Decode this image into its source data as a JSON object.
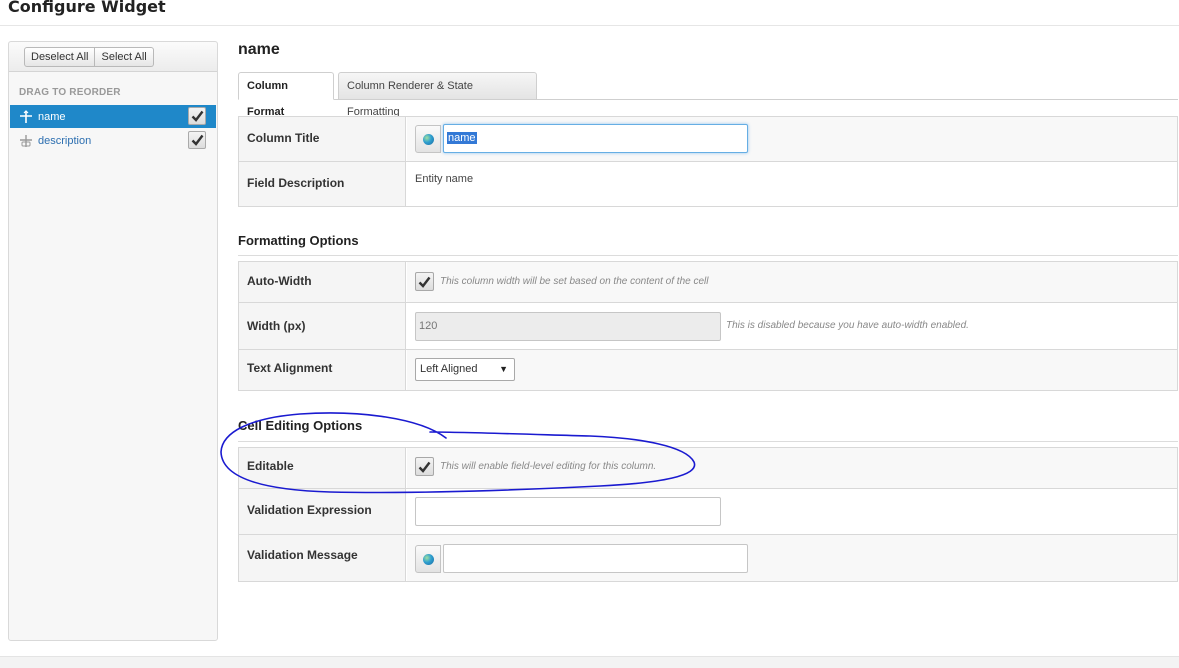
{
  "header": {
    "title": "Configure Widget"
  },
  "sidebar": {
    "buttons": {
      "deselect_all": "Deselect All",
      "select_all": "Select All"
    },
    "drag_label": "DRAG TO REORDER",
    "items": [
      {
        "label": "name",
        "checked": true,
        "selected": true
      },
      {
        "label": "description",
        "checked": true,
        "selected": false
      }
    ]
  },
  "main": {
    "title": "name",
    "tabs": [
      {
        "label": "Column Format",
        "active": true
      },
      {
        "label": "Column Renderer & State Formatting",
        "active": false
      }
    ],
    "general": {
      "column_title_label": "Column Title",
      "column_title_value": "name",
      "field_description_label": "Field Description",
      "field_description_value": "Entity name"
    },
    "formatting": {
      "section_title": "Formatting Options",
      "auto_width_label": "Auto-Width",
      "auto_width_checked": true,
      "auto_width_hint": "This column width will be set based on the content of the cell",
      "width_label": "Width (px)",
      "width_value": "120",
      "width_hint": "This is disabled because you have auto-width enabled.",
      "alignment_label": "Text Alignment",
      "alignment_value": "Left Aligned"
    },
    "cell_editing": {
      "section_title": "Cell Editing Options",
      "editable_label": "Editable",
      "editable_checked": true,
      "editable_hint": "This will enable field-level editing for this column.",
      "validation_expression_label": "Validation Expression",
      "validation_expression_value": "",
      "validation_message_label": "Validation Message",
      "validation_message_value": ""
    }
  },
  "colors": {
    "accent": "#1f88c9",
    "link": "#2d6fb0",
    "annotation": "#1a1ad0"
  }
}
